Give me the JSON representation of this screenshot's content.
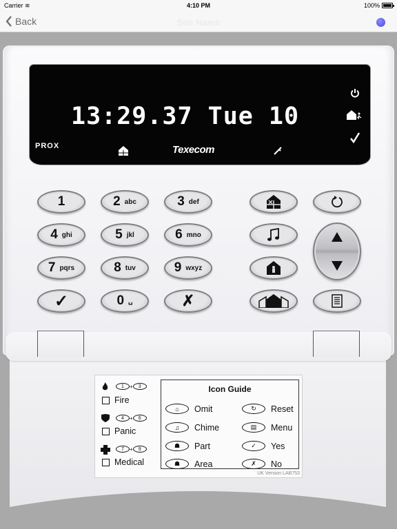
{
  "status_bar": {
    "carrier": "Carrier",
    "time": "4:10 PM",
    "battery": "100%"
  },
  "nav": {
    "back_label": "Back",
    "title": "Site Name",
    "status_dot_color": "#5656e6"
  },
  "display": {
    "text": "13:29.37 Tue 10",
    "prox_label": "PROX",
    "brand": "Texecom",
    "right_icons": [
      "power-icon",
      "house-exit-icon",
      "check-icon"
    ],
    "bottom_icons": [
      "omit-house-icon",
      "wrench-icon"
    ]
  },
  "keys": {
    "k1": {
      "num": "1",
      "sub": ""
    },
    "k2": {
      "num": "2",
      "sub": "abc"
    },
    "k3": {
      "num": "3",
      "sub": "def"
    },
    "k4": {
      "num": "4",
      "sub": "ghi"
    },
    "k5": {
      "num": "5",
      "sub": "jkl"
    },
    "k6": {
      "num": "6",
      "sub": "mno"
    },
    "k7": {
      "num": "7",
      "sub": "pqrs"
    },
    "k8": {
      "num": "8",
      "sub": "tuv"
    },
    "k9": {
      "num": "9",
      "sub": "wxyz"
    },
    "k0": {
      "num": "0",
      "sub": "␣"
    },
    "yes": "✓",
    "no": "✗"
  },
  "guide_card": {
    "title": "Icon Guide",
    "panic_combos": [
      {
        "label": "Fire",
        "keys": [
          "1",
          "3"
        ],
        "icon": "flame-icon"
      },
      {
        "label": "Panic",
        "keys": [
          "4",
          "6"
        ],
        "icon": "shield-icon"
      },
      {
        "label": "Medical",
        "keys": [
          "7",
          "9"
        ],
        "icon": "cross-icon"
      }
    ],
    "icons": [
      {
        "label": "Omit",
        "icon": "omit-house-icon"
      },
      {
        "label": "Reset",
        "icon": "reset-icon"
      },
      {
        "label": "Chime",
        "icon": "music-note-icon"
      },
      {
        "label": "Menu",
        "icon": "menu-icon"
      },
      {
        "label": "Part",
        "icon": "part-house-icon"
      },
      {
        "label": "Yes",
        "icon": "check-icon"
      },
      {
        "label": "Area",
        "icon": "area-house-icon"
      },
      {
        "label": "No",
        "icon": "x-icon"
      }
    ],
    "version": "UK Version LAB753"
  }
}
